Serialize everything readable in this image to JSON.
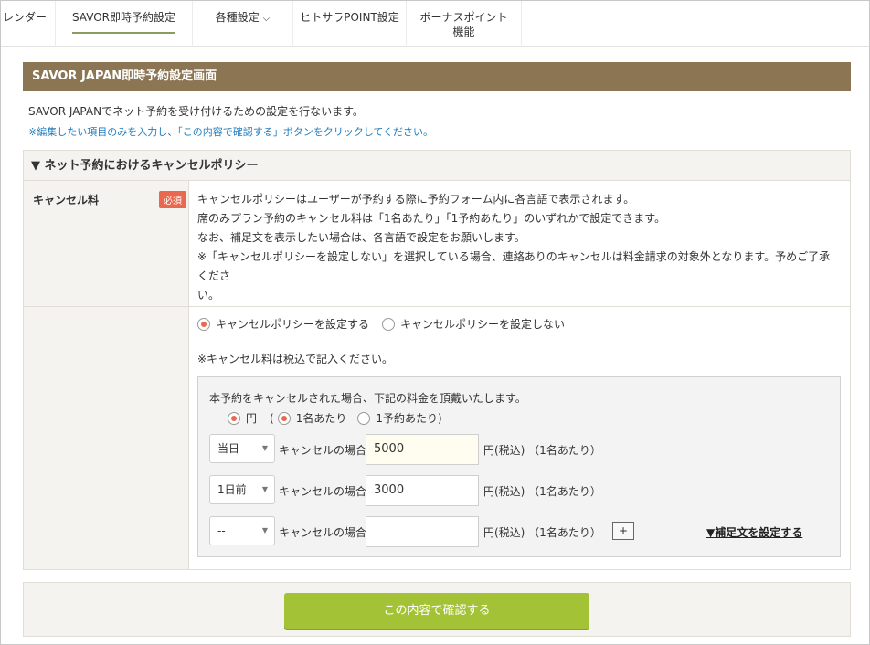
{
  "nav": {
    "items": [
      {
        "label": "レンダー"
      },
      {
        "label": "SAVOR即時予約設定"
      },
      {
        "label": "各種設定"
      },
      {
        "label": "ヒトサラPOINT設定"
      },
      {
        "label": "ボーナスポイント",
        "label2": "機能"
      }
    ]
  },
  "panel": {
    "title": "SAVOR JAPAN即時予約設定画面",
    "intro": "SAVOR JAPANでネット予約を受け付けるための設定を行ないます。",
    "instruction": "※編集したい項目のみを入力し、「この内容で確認する」ボタンをクリックしてください。"
  },
  "section": {
    "title": "▼ ネット予約におけるキャンセルポリシー",
    "field_label": "キャンセル料",
    "required_badge": "必須",
    "desc_lines": [
      "キャンセルポリシーはユーザーが予約する際に予約フォーム内に各言語で表示されます。",
      "席のみプラン予約のキャンセル料は「1名あたり」「1予約あたり」のいずれかで設定できます。",
      "なお、補足文を表示したい場合は、各言語で設定をお願いします。",
      "※「キャンセルポリシーを設定しない」を選択している場合、連絡ありのキャンセルは料金請求の対象外となります。予めご了承くださ",
      "い。"
    ],
    "policy_options": [
      "キャンセルポリシーを設定する",
      "キャンセルポリシーを設定しない"
    ],
    "note": "※キャンセル料は税込で記入ください。",
    "box_intro": "本予約をキャンセルされた場合、下記の料金を頂戴いたします。",
    "unit_option": "円",
    "paren_open": "(",
    "paren_close": ")",
    "per_options": [
      "1名あたり",
      "1予約あたり"
    ],
    "fees": [
      {
        "select": "当日",
        "label": "キャンセルの場合",
        "value": "5000",
        "unit": "円(税込) （1名あたり）"
      },
      {
        "select": "1日前",
        "label": "キャンセルの場合",
        "value": "3000",
        "unit": "円(税込) （1名あたり）"
      },
      {
        "select": "--",
        "label": "キャンセルの場合",
        "value": "",
        "unit": "円(税込) （1名あたり）"
      }
    ],
    "plus_label": "+",
    "supplement_link": "▼補足文を設定する"
  },
  "footer": {
    "confirm_label": "この内容で確認する"
  },
  "colors": {
    "header_brown": "#8b7553",
    "accent_red": "#e8694f",
    "link_blue": "#1f7bbd",
    "confirm_green": "#a3c235"
  }
}
